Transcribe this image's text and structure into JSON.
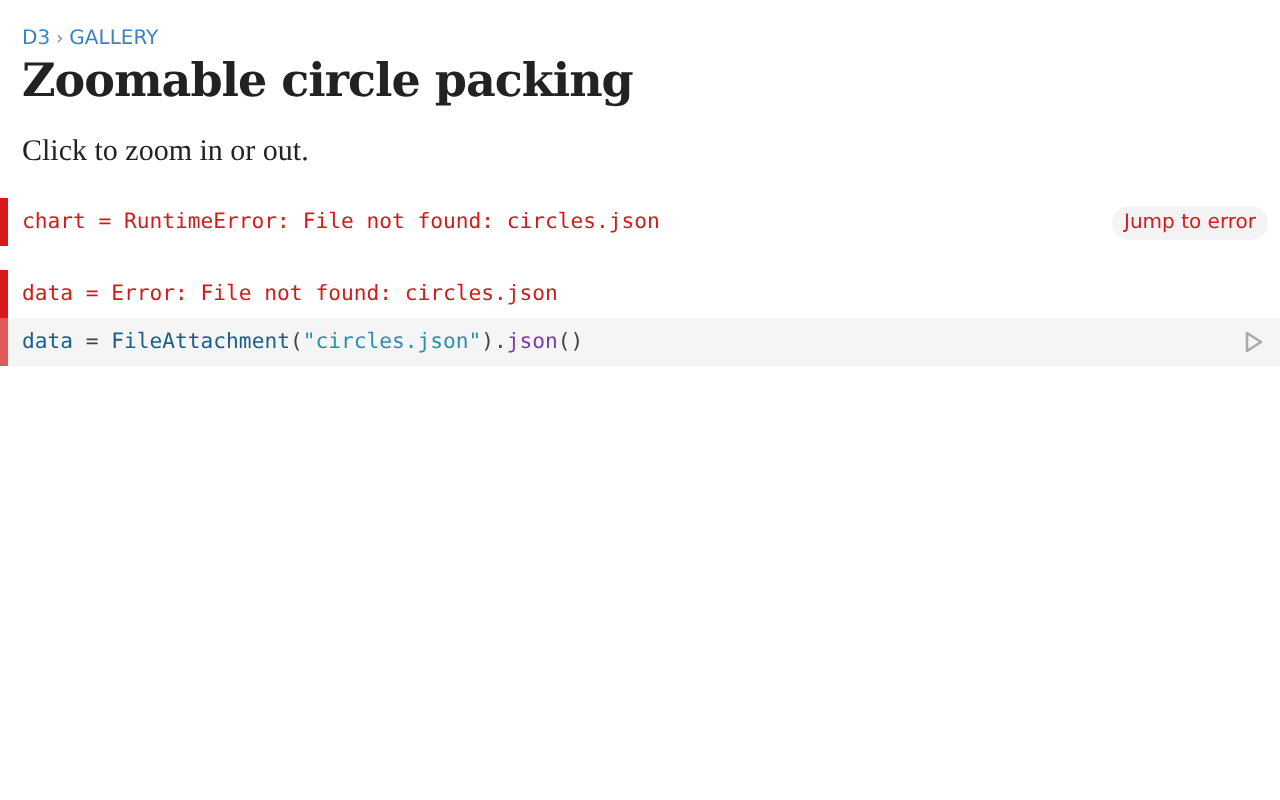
{
  "breadcrumb": [
    {
      "label": "D3"
    },
    {
      "label": "GALLERY"
    }
  ],
  "breadcrumb_separator": "›",
  "title": "Zoomable circle packing",
  "intro": "Click to zoom in or out.",
  "cells": [
    {
      "kind": "error",
      "text": "chart = RuntimeError: File not found: circles.json",
      "action": "Jump to error"
    },
    {
      "kind": "error",
      "text": "data = Error: File not found: circles.json"
    },
    {
      "kind": "code",
      "tokens": [
        {
          "kind": "name",
          "text": "data"
        },
        {
          "kind": "plain",
          "text": " = "
        },
        {
          "kind": "name",
          "text": "FileAttachment"
        },
        {
          "kind": "plain",
          "text": "("
        },
        {
          "kind": "string",
          "text": "\"circles.json\""
        },
        {
          "kind": "plain",
          "text": ")."
        },
        {
          "kind": "method",
          "text": "json"
        },
        {
          "kind": "plain",
          "text": "()"
        }
      ]
    }
  ]
}
